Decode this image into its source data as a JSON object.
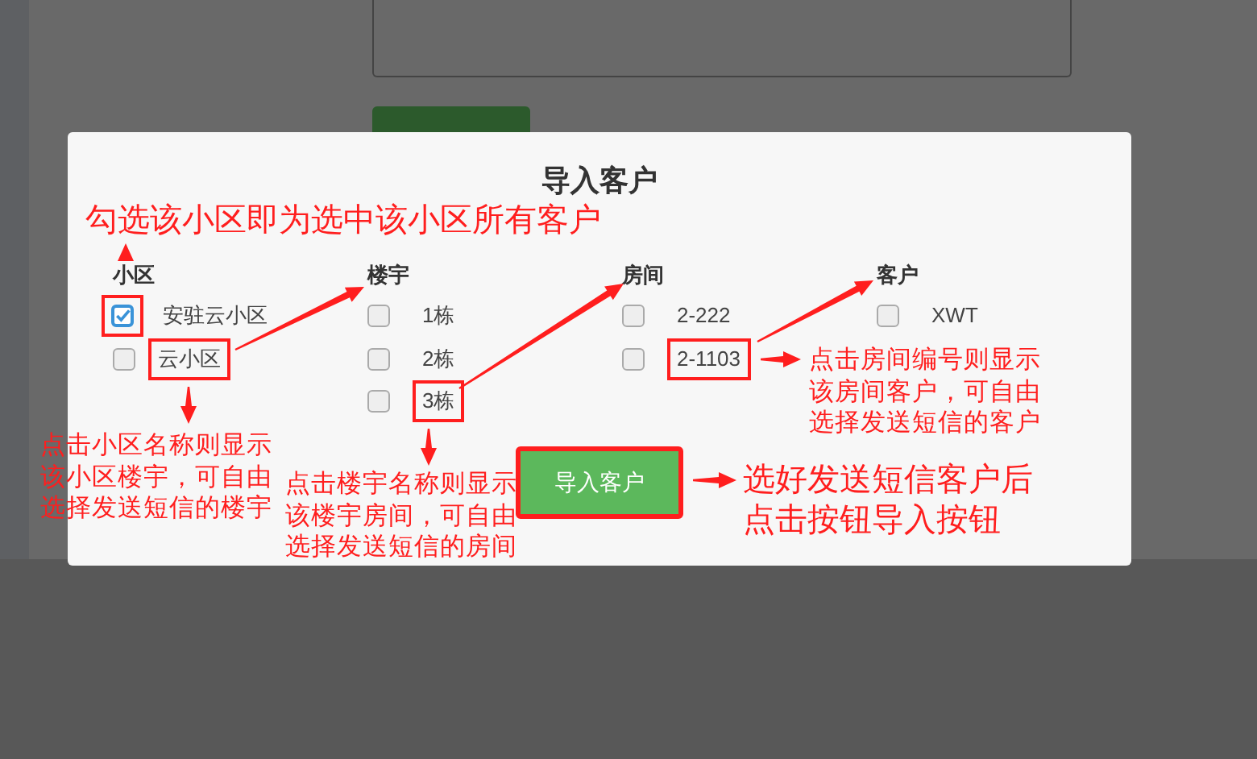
{
  "dialog": {
    "title": "导入客户",
    "columns": [
      {
        "heading": "小区",
        "items": [
          {
            "label": "安驻云小区",
            "checked": true,
            "checkbox_boxed": true,
            "label_boxed": false
          },
          {
            "label": "云小区",
            "checked": false,
            "checkbox_boxed": false,
            "label_boxed": true
          }
        ]
      },
      {
        "heading": "楼宇",
        "items": [
          {
            "label": "1栋",
            "checked": false,
            "checkbox_boxed": false,
            "label_boxed": false
          },
          {
            "label": "2栋",
            "checked": false,
            "checkbox_boxed": false,
            "label_boxed": false
          },
          {
            "label": "3栋",
            "checked": false,
            "checkbox_boxed": false,
            "label_boxed": true
          }
        ]
      },
      {
        "heading": "房间",
        "items": [
          {
            "label": "2-222",
            "checked": false,
            "checkbox_boxed": false,
            "label_boxed": false
          },
          {
            "label": "2-1103",
            "checked": false,
            "checkbox_boxed": false,
            "label_boxed": true
          }
        ]
      },
      {
        "heading": "客户",
        "items": [
          {
            "label": "XWT",
            "checked": false,
            "checkbox_boxed": false,
            "label_boxed": false
          }
        ]
      }
    ],
    "button": {
      "label": "导入客户",
      "highlighted": true
    }
  },
  "annotations": [
    {
      "text": "勾选该小区即为选中该小区所有客户"
    },
    {
      "text": "点击小区名称则显示该小区楼宇，可自由选择发送短信的楼宇"
    },
    {
      "text": "点击楼宇名称则显示该楼宇房间，可自由选择发送短信的房间"
    },
    {
      "text": "点击房间编号则显示该房间客户，可自由选择发送短信的客户"
    },
    {
      "text": "选好发送短信客户后点击按钮导入按钮"
    }
  ]
}
